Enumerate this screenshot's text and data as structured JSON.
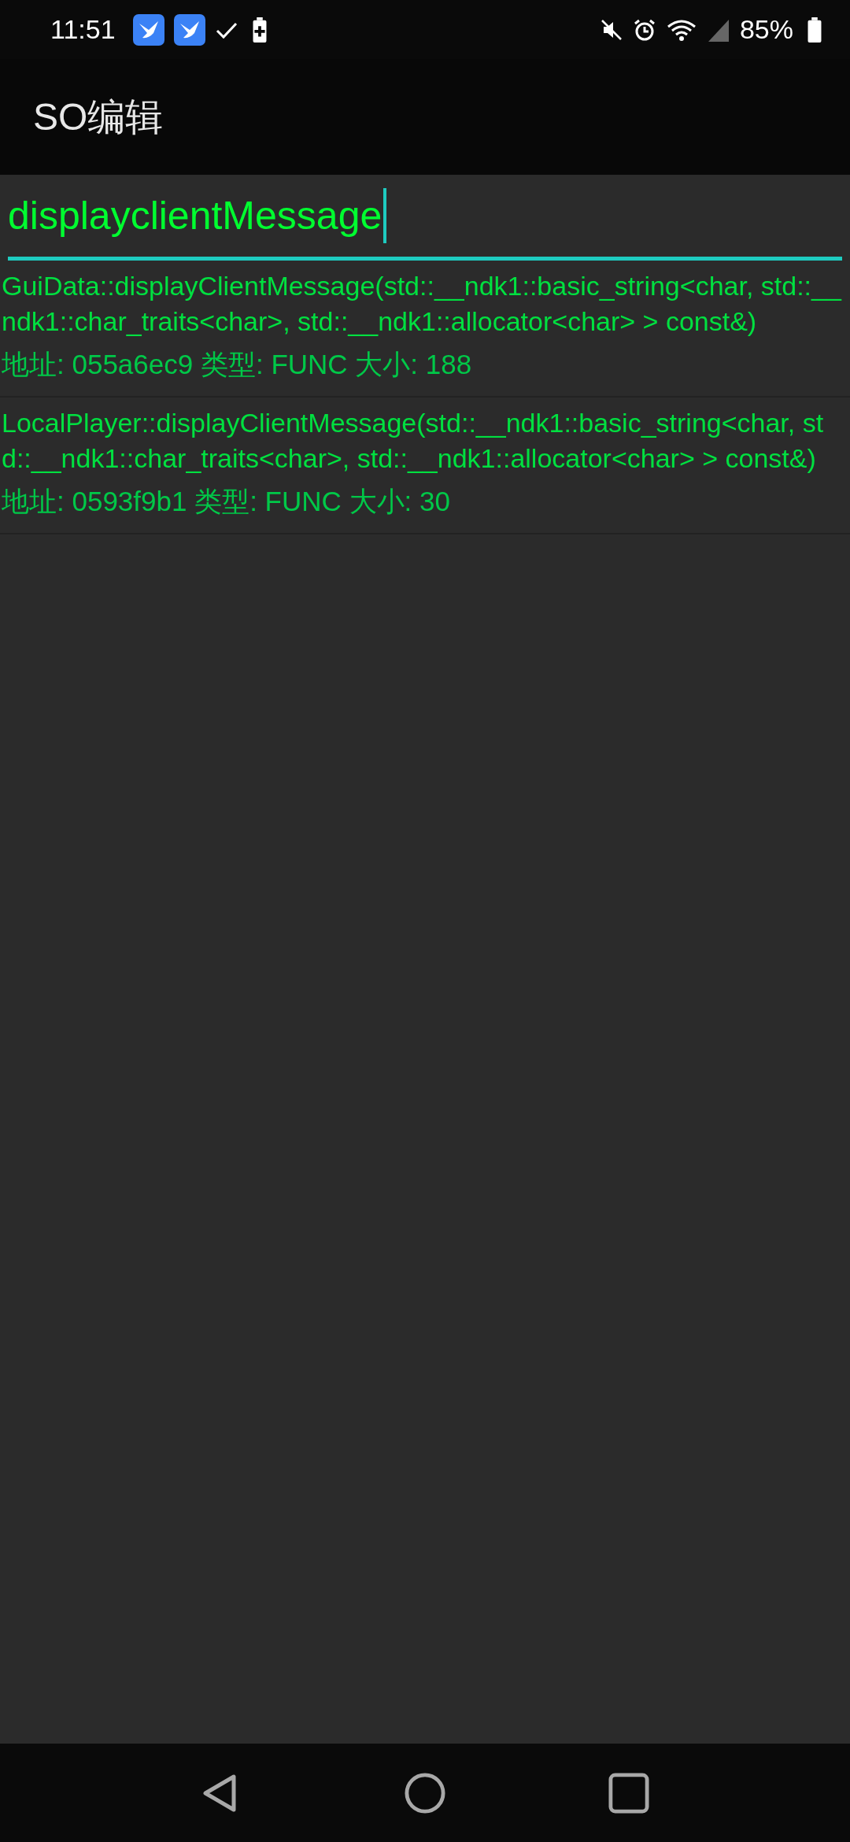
{
  "status_bar": {
    "time": "11:51",
    "battery": "85%"
  },
  "app_bar": {
    "title": "SO编辑"
  },
  "search": {
    "value": "displayclientMessage"
  },
  "results": [
    {
      "name": "GuiData::displayClientMessage(std::__ndk1::basic_string<char, std::__ndk1::char_traits<char>, std::__ndk1::allocator<char> > const&)",
      "details": "地址: 055a6ec9 类型: FUNC 大小: 188"
    },
    {
      "name": "LocalPlayer::displayClientMessage(std::__ndk1::basic_string<char, std::__ndk1::char_traits<char>, std::__ndk1::allocator<char> > const&)",
      "details": "地址: 0593f9b1 类型: FUNC 大小: 30"
    }
  ]
}
